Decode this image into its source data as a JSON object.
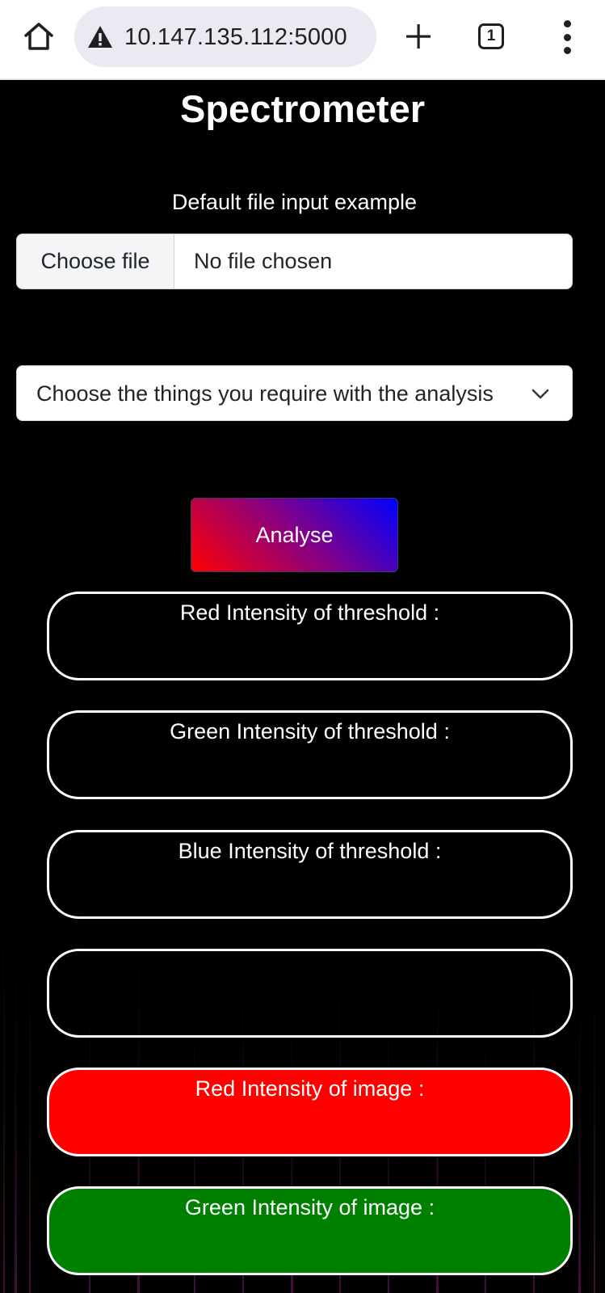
{
  "browser": {
    "url": "10.147.135.112:5000",
    "tab_count": "1"
  },
  "page": {
    "title": "Spectrometer",
    "file_label": "Default file input example",
    "file_button": "Choose file",
    "file_status": "No file chosen",
    "select_placeholder": "Choose the things you require with the analysis",
    "analyse_label": "Analyse",
    "boxes": [
      {
        "label": "Red Intensity of threshold :",
        "color": "#000000"
      },
      {
        "label": "Green Intensity of threshold :",
        "color": "#000000"
      },
      {
        "label": "Blue Intensity of threshold :",
        "color": "#000000"
      },
      {
        "label": "",
        "color": "#000000"
      },
      {
        "label": "Red Intensity of image :",
        "color": "#ff0000"
      },
      {
        "label": "Green Intensity of image :",
        "color": "#008000"
      }
    ]
  },
  "colors": {
    "analyse_gradient_start": "#ff0000",
    "analyse_gradient_end": "#0000ff"
  }
}
